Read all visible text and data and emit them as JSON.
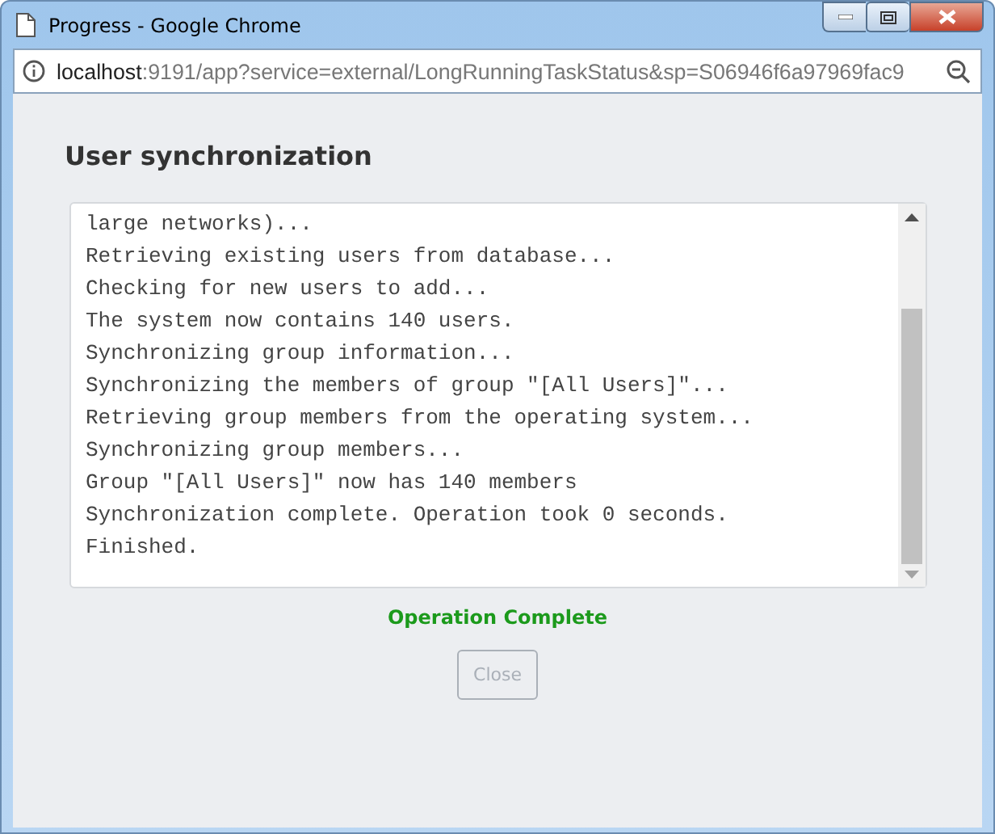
{
  "window": {
    "title": "Progress - Google Chrome"
  },
  "address_bar": {
    "host": "localhost",
    "path": ":9191/app?service=external/LongRunningTaskStatus&sp=S06946f6a97969fac9"
  },
  "dialog": {
    "title": "User synchronization",
    "log_lines": [
      "large networks)...",
      "Retrieving existing users from database...",
      "Checking for new users to add...",
      "The system now contains 140 users.",
      "Synchronizing group information...",
      "Synchronizing the members of group \"[All Users]\"...",
      "Retrieving group members from the operating system...",
      "Synchronizing group members...",
      "Group \"[All Users]\" now has 140 members",
      "Synchronization complete. Operation took 0 seconds.",
      "Finished."
    ],
    "status": {
      "text": "Operation Complete",
      "kind": "success"
    },
    "buttons": [
      {
        "label": "Close",
        "disabled": true
      }
    ]
  }
}
